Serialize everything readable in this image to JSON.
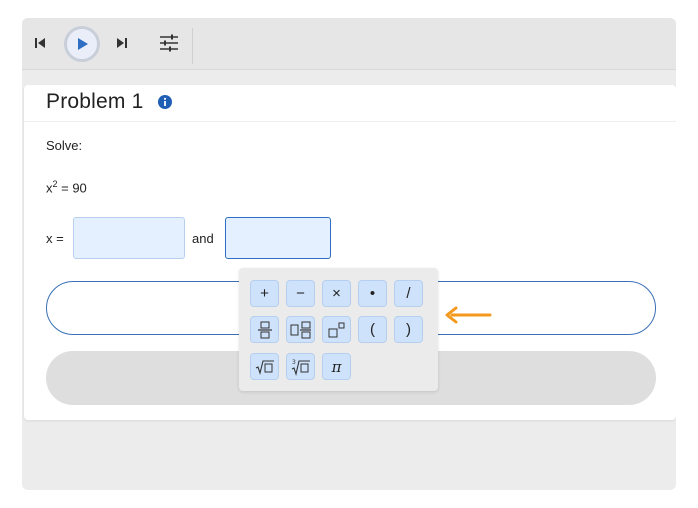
{
  "toolbar": {
    "icons": [
      "skip-back-icon",
      "play-icon",
      "skip-forward-icon",
      "settings-sliders-icon"
    ]
  },
  "problem": {
    "title": "Problem 1",
    "instruction": "Solve:",
    "equation": {
      "base": "x",
      "exponent": "2",
      "rest": " = 90"
    },
    "answer_prefix": "x =",
    "conjunction": "and",
    "answer_1_value": "",
    "answer_2_value": ""
  },
  "keypad": {
    "keys": [
      "+",
      "−",
      "×",
      "•",
      "/",
      "fraction",
      "mixed-number",
      "exponent",
      "(",
      ")",
      "square-root",
      "cube-root",
      "π"
    ]
  },
  "colors": {
    "accent": "#2f6fc3",
    "info_icon": "#1f5fb4",
    "key_fill": "#cfe2fb",
    "answer_fill": "#e4f0ff",
    "arrow": "#f39a1e"
  }
}
